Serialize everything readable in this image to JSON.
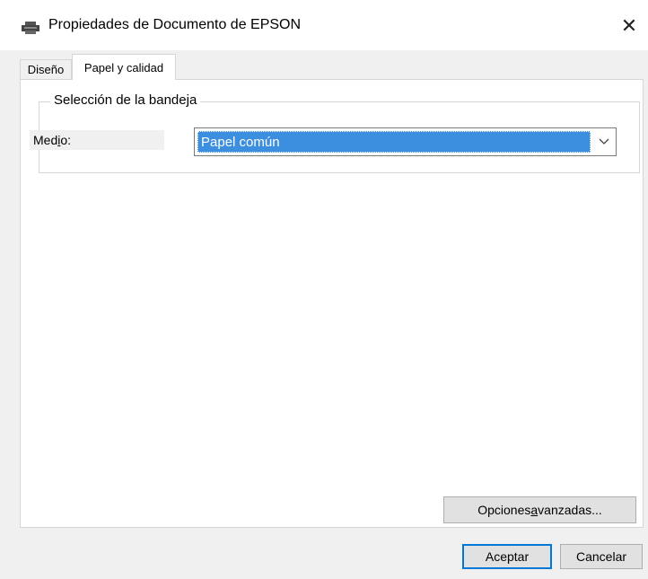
{
  "window": {
    "title": "Propiedades de Documento de EPSON",
    "close_glyph": "✕",
    "icon": "printer-icon"
  },
  "tabs": [
    {
      "label": "Diseño",
      "selected": false
    },
    {
      "label": "Papel y calidad",
      "selected": true
    }
  ],
  "tray_group": {
    "legend": "Selección de la bandeja",
    "medio_label_pre": "Med",
    "medio_label_accel": "i",
    "medio_label_post": "o:",
    "medio_value": "Papel común"
  },
  "advanced_button": {
    "pre": "Opciones ",
    "accel": "a",
    "post": "vanzadas..."
  },
  "footer": {
    "ok_label": "Aceptar",
    "cancel_label": "Cancelar"
  },
  "colors": {
    "selection": "#3c8ede",
    "default_button_border": "#0078d7"
  }
}
